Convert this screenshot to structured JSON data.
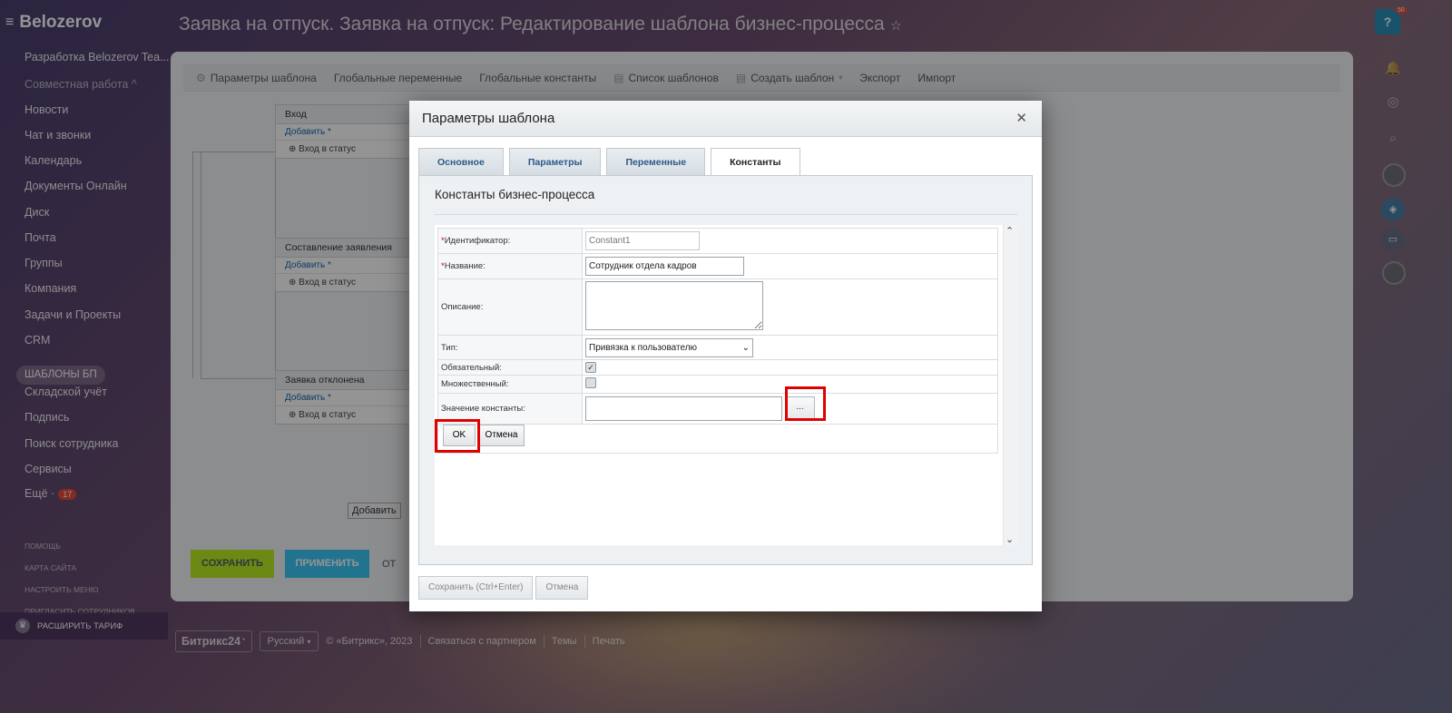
{
  "sidebar": {
    "logo": "Belozerov",
    "items": [
      {
        "label": "Разработка Belozerov Tea...",
        "dim": false
      },
      {
        "label": "Совместная работа ^",
        "dim": true
      },
      {
        "label": "Новости",
        "dim": false
      },
      {
        "label": "Чат и звонки",
        "dim": false
      },
      {
        "label": "Календарь",
        "dim": false
      },
      {
        "label": "Документы Онлайн",
        "dim": false
      },
      {
        "label": "Диск",
        "dim": false
      },
      {
        "label": "Почта",
        "dim": false
      },
      {
        "label": "Группы",
        "dim": false
      },
      {
        "label": "Компания",
        "dim": false
      },
      {
        "label": "Задачи и Проекты",
        "dim": false
      },
      {
        "label": "CRM",
        "dim": false
      }
    ],
    "pill": "ШАБЛОНЫ БП",
    "items2": [
      "Складской учёт",
      "Подпись",
      "Поиск сотрудника",
      "Сервисы"
    ],
    "more_label": "Ещё ·",
    "more_badge": "17",
    "small_links": [
      "ПОМОЩЬ",
      "КАРТА САЙТА",
      "НАСТРОИТЬ МЕНЮ",
      "ПРИГЛАСИТЬ СОТРУДНИКОВ"
    ],
    "tariff": "РАСШИРИТЬ ТАРИФ"
  },
  "page_title": "Заявка на отпуск. Заявка на отпуск: Редактирование шаблона бизнес-процесса",
  "toolbar": {
    "items": [
      "Параметры шаблона",
      "Глобальные переменные",
      "Глобальные константы",
      "Список шаблонов",
      "Создать шаблон",
      "Экспорт",
      "Импорт"
    ]
  },
  "blocks": [
    {
      "title": "Вход",
      "add": "Добавить *",
      "line": "Вход в статус"
    },
    {
      "title": "Составление заявления",
      "add": "Добавить *",
      "line": "Вход в статус"
    },
    {
      "title": "Заявка отклонена",
      "add": "Добавить *",
      "line": "Вход в статус"
    }
  ],
  "workspace": {
    "add_btn": "Добавить",
    "save": "СОХРАНИТЬ",
    "apply": "ПРИМЕНИТЬ",
    "cancel": "ОТ"
  },
  "footer": {
    "brand": "Битрикс24",
    "lang": "Русский",
    "copyright": "© «Битрикс», 2023",
    "links": [
      "Связаться с партнером",
      "Темы",
      "Печать"
    ]
  },
  "right_panel": {
    "help_badge": "50"
  },
  "modal": {
    "title": "Параметры шаблона",
    "tabs": [
      "Основное",
      "Параметры",
      "Переменные",
      "Константы"
    ],
    "active_tab": 3,
    "section_title": "Константы бизнес-процесса",
    "form": {
      "id_label": "Идентификатор:",
      "id_placeholder": "Constant1",
      "name_label": "Название:",
      "name_value": "Сотрудник отдела кадров",
      "desc_label": "Описание:",
      "type_label": "Тип:",
      "type_value": "Привязка к пользователю",
      "required_label": "Обязательный:",
      "required_checked": true,
      "multiple_label": "Множественный:",
      "multiple_checked": false,
      "value_label": "Значение константы:",
      "value_value": "",
      "dots_label": "...",
      "ok_label": "OK",
      "cancel_label": "Отмена"
    },
    "footer_save": "Сохранить (Ctrl+Enter)",
    "footer_cancel": "Отмена"
  },
  "colors": {
    "highlight": "#e00000",
    "save_green": "#bbed21",
    "apply_blue": "#3bc8f5",
    "link_blue": "#2067b0"
  }
}
